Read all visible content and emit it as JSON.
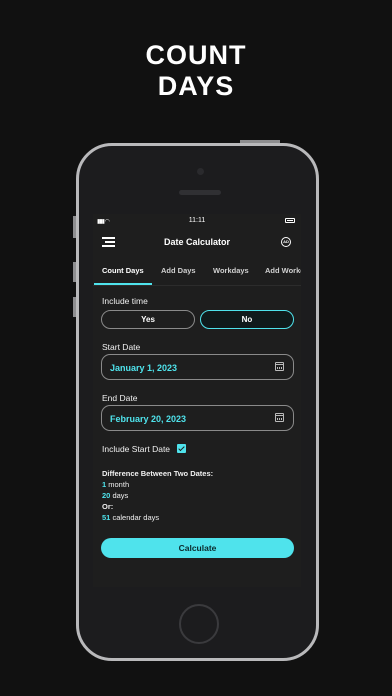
{
  "promo": {
    "line1": "COUNT",
    "line2": "DAYS"
  },
  "status": {
    "time": "11:11"
  },
  "appbar": {
    "title": "Date Calculator",
    "ad_label": "AD"
  },
  "tabs": [
    {
      "label": "Count Days"
    },
    {
      "label": "Add Days"
    },
    {
      "label": "Workdays"
    },
    {
      "label": "Add Workd"
    }
  ],
  "include_time": {
    "label": "Include time",
    "yes": "Yes",
    "no": "No",
    "selected": "No"
  },
  "start_date": {
    "label": "Start Date",
    "value": "January 1, 2023"
  },
  "end_date": {
    "label": "End Date",
    "value": "February 20, 2023"
  },
  "include_start": {
    "label": "Include Start Date",
    "checked": true
  },
  "result": {
    "heading": "Difference Between Two Dates:",
    "months": "1",
    "months_unit": "month",
    "days": "20",
    "days_unit": "days",
    "or_label": "Or:",
    "calendar_days": "51",
    "calendar_unit": "calendar days"
  },
  "calculate_label": "Calculate",
  "colors": {
    "accent": "#4fe3ec",
    "background": "#111111",
    "screen": "#1e1e1e"
  }
}
